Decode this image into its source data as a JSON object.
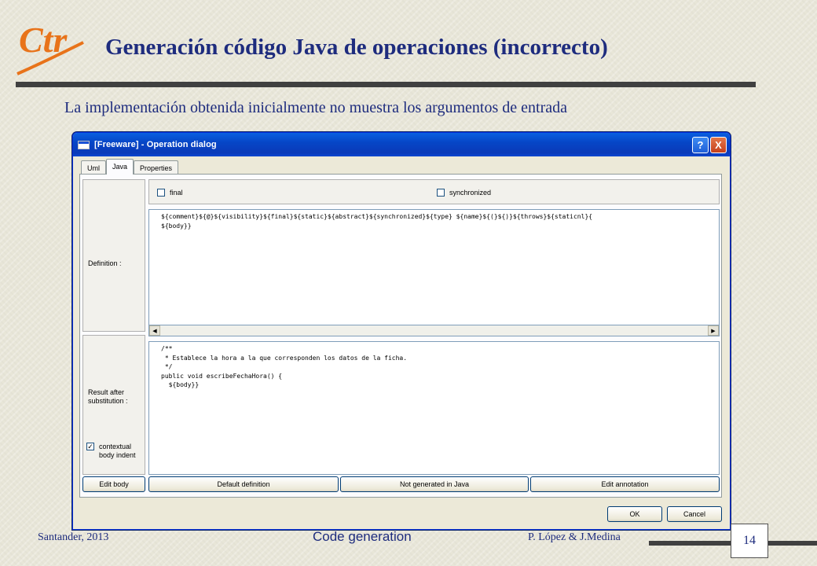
{
  "slide": {
    "logo_text": "Ctr",
    "title": "Generación código Java de operaciones (incorrecto)",
    "subtitle": "La implementación obtenida inicialmente no muestra los argumentos de entrada",
    "footer_left": "Santander, 2013",
    "footer_center": "Code generation",
    "footer_right": "P. López & J.Medina",
    "page_number": "14",
    "accent_color": "#1e2c7e",
    "logo_color": "#e8731a"
  },
  "window": {
    "title": "[Freeware] - Operation dialog",
    "help_button": "?",
    "close_button": "X",
    "tabs": [
      {
        "label": "Uml",
        "active": false
      },
      {
        "label": "Java",
        "active": true
      },
      {
        "label": "Properties",
        "active": false
      }
    ],
    "options": {
      "final_label": "final",
      "final_checked": false,
      "synchronized_label": "synchronized",
      "synchronized_checked": false
    },
    "definition": {
      "label": "Definition :",
      "code": "${comment}${@}${visibility}${final}${static}${abstract}${synchronized}${type} ${name}${(}${)}${throws}${staticnl}{\n${body}}"
    },
    "result": {
      "label": "Result after substitution :",
      "code": "/**\n * Establece la hora a la que corresponden los datos de la ficha.\n */\npublic void escribeFechaHora() {\n  ${body}}"
    },
    "contextual": {
      "label": "contextual body indent",
      "checked": true
    },
    "buttons": {
      "edit_body": "Edit body",
      "default_definition": "Default definition",
      "not_generated": "Not generated in Java",
      "edit_annotation": "Edit annotation",
      "ok": "OK",
      "cancel": "Cancel"
    }
  }
}
